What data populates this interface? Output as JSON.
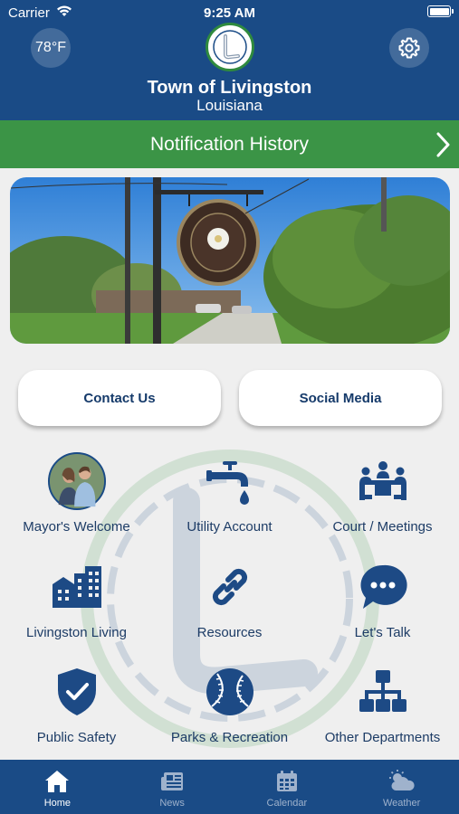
{
  "status": {
    "carrier": "Carrier",
    "time": "9:25 AM"
  },
  "header": {
    "temperature": "78°F",
    "title": "Town of Livingston",
    "subtitle": "Louisiana"
  },
  "notification_bar": {
    "label": "Notification History"
  },
  "buttons": {
    "contact": "Contact Us",
    "social": "Social Media"
  },
  "grid": [
    {
      "label": "Mayor's Welcome",
      "icon": "mayor-photo"
    },
    {
      "label": "Utility Account",
      "icon": "water-faucet-icon"
    },
    {
      "label": "Court / Meetings",
      "icon": "meeting-icon"
    },
    {
      "label": "Livingston Living",
      "icon": "city-buildings-icon"
    },
    {
      "label": "Resources",
      "icon": "link-icon"
    },
    {
      "label": "Let's Talk",
      "icon": "chat-bubble-icon"
    },
    {
      "label": "Public Safety",
      "icon": "shield-check-icon"
    },
    {
      "label": "Parks & Recreation",
      "icon": "baseball-icon"
    },
    {
      "label": "Other Departments",
      "icon": "org-chart-icon"
    }
  ],
  "tabs": [
    {
      "label": "Home",
      "icon": "home-icon",
      "active": true
    },
    {
      "label": "News",
      "icon": "newspaper-icon",
      "active": false
    },
    {
      "label": "Calendar",
      "icon": "calendar-icon",
      "active": false
    },
    {
      "label": "Weather",
      "icon": "weather-icon",
      "active": false
    }
  ],
  "colors": {
    "header_blue": "#1a4b86",
    "notif_green": "#3b9446",
    "icon_blue": "#1d4a85",
    "background": "#efefef"
  }
}
